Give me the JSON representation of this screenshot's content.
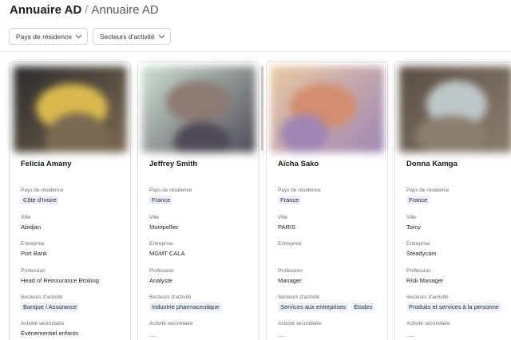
{
  "header": {
    "root": "Annuaire AD",
    "separator": "/",
    "current": "Annuaire AD"
  },
  "filters": [
    {
      "label": "Pays de résidence"
    },
    {
      "label": "Secteurs d'activité"
    }
  ],
  "labels": {
    "country": "Pays de résidence",
    "city": "Ville",
    "company": "Entreprise",
    "profession": "Profession",
    "sectors": "Secteurs d'activité",
    "secondary": "Activité secondaire"
  },
  "members": [
    {
      "name": "Felicia Amany",
      "country": "Côte d'Ivoire",
      "city": "Abidjan",
      "company": "Port Bank",
      "profession": "Head of Reinsurance Broking",
      "sectors": [
        "Banque / Assurance"
      ],
      "secondary": "Événementiel enfants",
      "photo_colors": [
        "#2b2a2c",
        "#d9b94e",
        "#7a6a52"
      ]
    },
    {
      "name": "Jeffrey Smith",
      "country": "France",
      "city": "Montpellier",
      "company": "MGMT CALA",
      "profession": "Analyste",
      "sectors": [
        "Industrie pharmaceutique"
      ],
      "secondary": "",
      "photo_colors": [
        "#cfe0d2",
        "#8c7a74",
        "#4f4a56"
      ]
    },
    {
      "name": "Aïcha Sako",
      "country": "France",
      "city": "PARIS",
      "company": "",
      "profession": "Manager",
      "sectors": [
        "Services aux entreprises",
        "Études"
      ],
      "secondary": "",
      "photo_colors": [
        "#e9c9a2",
        "#d38d6f",
        "#9f86b4"
      ]
    },
    {
      "name": "Donna Kamga",
      "country": "France",
      "city": "Torcy",
      "company": "Steadycam",
      "profession": "Risk Manager",
      "sectors": [
        "Produits et services à la personne"
      ],
      "secondary": "",
      "photo_colors": [
        "#5a4e44",
        "#bfc6c8",
        "#8a7e6e"
      ]
    }
  ]
}
